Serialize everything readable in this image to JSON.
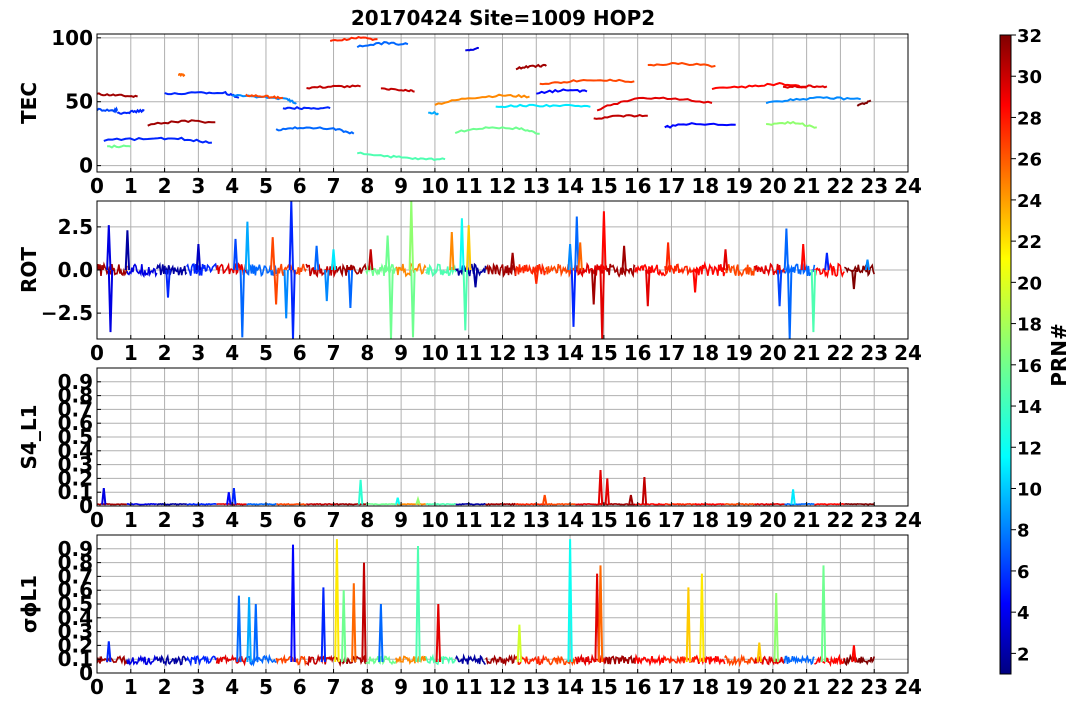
{
  "title": "20170424 Site=1009 HOP2",
  "colorbar": {
    "label": "PRN#",
    "min": 1,
    "max": 32,
    "ticks": [
      2,
      4,
      6,
      8,
      10,
      12,
      14,
      16,
      18,
      20,
      22,
      24,
      26,
      28,
      30,
      32
    ],
    "colormap": "jet"
  },
  "chart_data": [
    {
      "type": "line",
      "ylabel": "TEC",
      "xlim": [
        0,
        24
      ],
      "ylim": [
        -5,
        103
      ],
      "xticks": [
        0,
        1,
        2,
        3,
        4,
        5,
        6,
        7,
        8,
        9,
        10,
        11,
        12,
        13,
        14,
        15,
        16,
        17,
        18,
        19,
        20,
        21,
        22,
        23,
        24
      ],
      "yticks": [
        0,
        50,
        100
      ],
      "grid": true,
      "arcs": [
        {
          "prn": 31,
          "x": [
            0.0,
            0.6,
            1.2
          ],
          "y": [
            56,
            55,
            54
          ]
        },
        {
          "prn": 7,
          "x": [
            0.0,
            0.5,
            0.6
          ],
          "y": [
            44,
            43,
            44
          ]
        },
        {
          "prn": 6,
          "x": [
            0.6,
            1.0,
            1.4
          ],
          "y": [
            41,
            42,
            43
          ]
        },
        {
          "prn": 6,
          "x": [
            0.2,
            1.5,
            2.5,
            3.4
          ],
          "y": [
            20,
            21,
            21,
            18
          ]
        },
        {
          "prn": 16,
          "x": [
            0.3,
            1.0
          ],
          "y": [
            15,
            15
          ]
        },
        {
          "prn": 31,
          "x": [
            1.5,
            2.5,
            3.5
          ],
          "y": [
            32,
            35,
            34
          ]
        },
        {
          "prn": 25,
          "x": [
            2.4,
            2.6
          ],
          "y": [
            71,
            71
          ]
        },
        {
          "prn": 6,
          "x": [
            2.0,
            3.0,
            3.8,
            4.2
          ],
          "y": [
            56,
            57,
            57,
            53
          ]
        },
        {
          "prn": 9,
          "x": [
            4.0,
            4.8,
            5.6,
            5.9
          ],
          "y": [
            55,
            54,
            52,
            49
          ]
        },
        {
          "prn": 26,
          "x": [
            4.4,
            5.0,
            5.5
          ],
          "y": [
            55,
            54,
            53
          ]
        },
        {
          "prn": 6,
          "x": [
            5.5,
            6.2,
            6.9
          ],
          "y": [
            45,
            45,
            45
          ]
        },
        {
          "prn": 8,
          "x": [
            5.3,
            6.0,
            7.0,
            7.6
          ],
          "y": [
            28,
            30,
            29,
            25
          ]
        },
        {
          "prn": 30,
          "x": [
            6.2,
            7.0,
            7.8
          ],
          "y": [
            61,
            62,
            62
          ]
        },
        {
          "prn": 27,
          "x": [
            6.9,
            7.6,
            8.3
          ],
          "y": [
            97,
            100,
            99
          ]
        },
        {
          "prn": 8,
          "x": [
            7.7,
            8.5,
            9.2
          ],
          "y": [
            93,
            96,
            95
          ]
        },
        {
          "prn": 30,
          "x": [
            8.4,
            9.0,
            9.4
          ],
          "y": [
            60,
            59,
            58
          ]
        },
        {
          "prn": 15,
          "x": [
            7.7,
            8.7,
            9.5,
            10.3
          ],
          "y": [
            10,
            7,
            5,
            5
          ]
        },
        {
          "prn": 10,
          "x": [
            9.8,
            10.1
          ],
          "y": [
            41,
            41
          ]
        },
        {
          "prn": 24,
          "x": [
            10.0,
            11.0,
            12.0,
            12.8
          ],
          "y": [
            48,
            53,
            55,
            54
          ]
        },
        {
          "prn": 4,
          "x": [
            10.9,
            11.3
          ],
          "y": [
            90,
            92
          ]
        },
        {
          "prn": 16,
          "x": [
            10.6,
            11.5,
            12.5,
            13.1
          ],
          "y": [
            26,
            30,
            29,
            25
          ]
        },
        {
          "prn": 12,
          "x": [
            11.8,
            12.7,
            13.7,
            14.6
          ],
          "y": [
            46,
            47,
            47,
            46
          ]
        },
        {
          "prn": 31,
          "x": [
            12.4,
            12.9,
            13.3
          ],
          "y": [
            76,
            78,
            78
          ]
        },
        {
          "prn": 26,
          "x": [
            13.1,
            14.0,
            15.0,
            15.9
          ],
          "y": [
            64,
            66,
            67,
            66
          ]
        },
        {
          "prn": 5,
          "x": [
            13.0,
            13.8,
            14.5
          ],
          "y": [
            57,
            59,
            58
          ]
        },
        {
          "prn": 30,
          "x": [
            14.7,
            15.5,
            16.3
          ],
          "y": [
            37,
            39,
            39
          ]
        },
        {
          "prn": 29,
          "x": [
            14.8,
            15.8,
            17.0,
            18.2
          ],
          "y": [
            44,
            52,
            53,
            49
          ]
        },
        {
          "prn": 5,
          "x": [
            16.8,
            17.6,
            18.9
          ],
          "y": [
            30,
            33,
            32
          ]
        },
        {
          "prn": 26,
          "x": [
            16.3,
            17.2,
            18.3
          ],
          "y": [
            78,
            80,
            78
          ]
        },
        {
          "prn": 28,
          "x": [
            18.2,
            19.3,
            20.2,
            21.0
          ],
          "y": [
            60,
            62,
            64,
            61
          ]
        },
        {
          "prn": 29,
          "x": [
            20.3,
            21.0,
            21.6
          ],
          "y": [
            61,
            62,
            62
          ]
        },
        {
          "prn": 9,
          "x": [
            19.8,
            20.6,
            21.6,
            22.6
          ],
          "y": [
            49,
            52,
            53,
            52
          ]
        },
        {
          "prn": 17,
          "x": [
            19.8,
            20.6,
            21.3
          ],
          "y": [
            32,
            34,
            30
          ]
        },
        {
          "prn": 32,
          "x": [
            22.5,
            22.9
          ],
          "y": [
            47,
            51
          ]
        }
      ]
    },
    {
      "type": "line",
      "ylabel": "ROT",
      "xlim": [
        0,
        24
      ],
      "ylim": [
        -4,
        4
      ],
      "xticks": [
        0,
        1,
        2,
        3,
        4,
        5,
        6,
        7,
        8,
        9,
        10,
        11,
        12,
        13,
        14,
        15,
        16,
        17,
        18,
        19,
        20,
        21,
        22,
        23,
        24
      ],
      "yticks": [
        -2.5,
        0.0,
        2.5
      ],
      "ytick_labels": [
        "−2.5",
        "0.0",
        "2.5"
      ],
      "grid": true,
      "baseline": 0,
      "spikes": [
        {
          "prn": 4,
          "x": 0.35,
          "y": 2.6
        },
        {
          "prn": 4,
          "x": 0.4,
          "y": -3.6
        },
        {
          "prn": 2,
          "x": 0.9,
          "y": 2.3
        },
        {
          "prn": 6,
          "x": 2.1,
          "y": -1.6
        },
        {
          "prn": 3,
          "x": 3.0,
          "y": 1.5
        },
        {
          "prn": 7,
          "x": 4.1,
          "y": 1.8
        },
        {
          "prn": 8,
          "x": 4.3,
          "y": -3.9
        },
        {
          "prn": 10,
          "x": 4.45,
          "y": 2.8
        },
        {
          "prn": 26,
          "x": 5.2,
          "y": 1.9
        },
        {
          "prn": 26,
          "x": 5.3,
          "y": -2.0
        },
        {
          "prn": 9,
          "x": 5.6,
          "y": -2.8
        },
        {
          "prn": 6,
          "x": 5.75,
          "y": 4.0
        },
        {
          "prn": 6,
          "x": 5.8,
          "y": -4.0
        },
        {
          "prn": 8,
          "x": 6.5,
          "y": 1.4
        },
        {
          "prn": 9,
          "x": 6.8,
          "y": -1.8
        },
        {
          "prn": 12,
          "x": 7.0,
          "y": 1.2
        },
        {
          "prn": 8,
          "x": 7.5,
          "y": -2.2
        },
        {
          "prn": 30,
          "x": 8.1,
          "y": 1.2
        },
        {
          "prn": 16,
          "x": 8.6,
          "y": 2.0
        },
        {
          "prn": 16,
          "x": 8.7,
          "y": -4.0
        },
        {
          "prn": 17,
          "x": 9.3,
          "y": 4.0
        },
        {
          "prn": 16,
          "x": 9.35,
          "y": -3.9
        },
        {
          "prn": 24,
          "x": 10.5,
          "y": 2.2
        },
        {
          "prn": 13,
          "x": 10.8,
          "y": 3.0
        },
        {
          "prn": 15,
          "x": 10.9,
          "y": -3.5
        },
        {
          "prn": 22,
          "x": 11.0,
          "y": 2.6
        },
        {
          "prn": 2,
          "x": 11.2,
          "y": -1.0
        },
        {
          "prn": 31,
          "x": 12.3,
          "y": 1.0
        },
        {
          "prn": 27,
          "x": 13.0,
          "y": -0.8
        },
        {
          "prn": 9,
          "x": 14.0,
          "y": 1.5
        },
        {
          "prn": 6,
          "x": 14.1,
          "y": -3.3
        },
        {
          "prn": 8,
          "x": 14.2,
          "y": 3.1
        },
        {
          "prn": 25,
          "x": 14.3,
          "y": 1.6
        },
        {
          "prn": 31,
          "x": 14.7,
          "y": -2.0
        },
        {
          "prn": 28,
          "x": 15.0,
          "y": 3.4
        },
        {
          "prn": 29,
          "x": 14.95,
          "y": -4.0
        },
        {
          "prn": 31,
          "x": 15.6,
          "y": 1.4
        },
        {
          "prn": 29,
          "x": 16.3,
          "y": -2.1
        },
        {
          "prn": 27,
          "x": 16.9,
          "y": 1.6
        },
        {
          "prn": 28,
          "x": 17.7,
          "y": -1.3
        },
        {
          "prn": 29,
          "x": 18.6,
          "y": 1.2
        },
        {
          "prn": 7,
          "x": 20.2,
          "y": -2.1
        },
        {
          "prn": 8,
          "x": 20.4,
          "y": 2.4
        },
        {
          "prn": 8,
          "x": 20.5,
          "y": -4.0
        },
        {
          "prn": 28,
          "x": 20.9,
          "y": 1.5
        },
        {
          "prn": 15,
          "x": 21.2,
          "y": -3.6
        },
        {
          "prn": 6,
          "x": 21.6,
          "y": 1.0
        },
        {
          "prn": 32,
          "x": 22.4,
          "y": -1.1
        },
        {
          "prn": 9,
          "x": 22.8,
          "y": 0.6
        }
      ]
    },
    {
      "type": "line",
      "ylabel": "S4_L1",
      "xlim": [
        0,
        24
      ],
      "ylim": [
        0,
        1
      ],
      "xticks": [
        0,
        1,
        2,
        3,
        4,
        5,
        6,
        7,
        8,
        9,
        10,
        11,
        12,
        13,
        14,
        15,
        16,
        17,
        18,
        19,
        20,
        21,
        22,
        23,
        24
      ],
      "yticks": [
        0.0,
        0.1,
        0.2,
        0.3,
        0.4,
        0.5,
        0.6,
        0.7,
        0.8,
        0.9
      ],
      "grid": true,
      "baseline": 0.01,
      "peaks": [
        {
          "prn": 4,
          "x": 0.2,
          "y": 0.13
        },
        {
          "prn": 5,
          "x": 3.9,
          "y": 0.1
        },
        {
          "prn": 6,
          "x": 4.05,
          "y": 0.13
        },
        {
          "prn": 14,
          "x": 7.8,
          "y": 0.19
        },
        {
          "prn": 13,
          "x": 8.9,
          "y": 0.06
        },
        {
          "prn": 17,
          "x": 9.5,
          "y": 0.05
        },
        {
          "prn": 26,
          "x": 13.25,
          "y": 0.08
        },
        {
          "prn": 29,
          "x": 14.9,
          "y": 0.26
        },
        {
          "prn": 29,
          "x": 15.1,
          "y": 0.2
        },
        {
          "prn": 31,
          "x": 15.8,
          "y": 0.08
        },
        {
          "prn": 30,
          "x": 16.2,
          "y": 0.21
        },
        {
          "prn": 12,
          "x": 20.6,
          "y": 0.12
        }
      ]
    },
    {
      "type": "line",
      "ylabel": "σϕL1",
      "xlim": [
        0,
        24
      ],
      "ylim": [
        0,
        1
      ],
      "xticks": [
        0,
        1,
        2,
        3,
        4,
        5,
        6,
        7,
        8,
        9,
        10,
        11,
        12,
        13,
        14,
        15,
        16,
        17,
        18,
        19,
        20,
        21,
        22,
        23,
        24
      ],
      "yticks": [
        0.0,
        0.1,
        0.2,
        0.3,
        0.4,
        0.5,
        0.6,
        0.7,
        0.8,
        0.9
      ],
      "grid": true,
      "baseline": 0.08,
      "peaks": [
        {
          "prn": 6,
          "x": 0.35,
          "y": 0.23
        },
        {
          "prn": 8,
          "x": 4.2,
          "y": 0.56
        },
        {
          "prn": 10,
          "x": 4.5,
          "y": 0.55
        },
        {
          "prn": 8,
          "x": 4.7,
          "y": 0.5
        },
        {
          "prn": 5,
          "x": 5.8,
          "y": 0.93
        },
        {
          "prn": 6,
          "x": 6.7,
          "y": 0.62
        },
        {
          "prn": 21,
          "x": 7.1,
          "y": 0.97
        },
        {
          "prn": 16,
          "x": 7.3,
          "y": 0.6
        },
        {
          "prn": 25,
          "x": 7.6,
          "y": 0.65
        },
        {
          "prn": 30,
          "x": 7.9,
          "y": 0.8
        },
        {
          "prn": 8,
          "x": 8.4,
          "y": 0.5
        },
        {
          "prn": 15,
          "x": 9.5,
          "y": 0.92
        },
        {
          "prn": 29,
          "x": 10.1,
          "y": 0.5
        },
        {
          "prn": 19,
          "x": 12.5,
          "y": 0.35
        },
        {
          "prn": 13,
          "x": 14.0,
          "y": 0.97
        },
        {
          "prn": 29,
          "x": 14.8,
          "y": 0.72
        },
        {
          "prn": 25,
          "x": 14.9,
          "y": 0.78
        },
        {
          "prn": 22,
          "x": 17.5,
          "y": 0.62
        },
        {
          "prn": 21,
          "x": 17.9,
          "y": 0.72
        },
        {
          "prn": 22,
          "x": 19.6,
          "y": 0.22
        },
        {
          "prn": 17,
          "x": 20.1,
          "y": 0.58
        },
        {
          "prn": 16,
          "x": 21.5,
          "y": 0.78
        },
        {
          "prn": 28,
          "x": 22.4,
          "y": 0.2
        }
      ]
    }
  ]
}
